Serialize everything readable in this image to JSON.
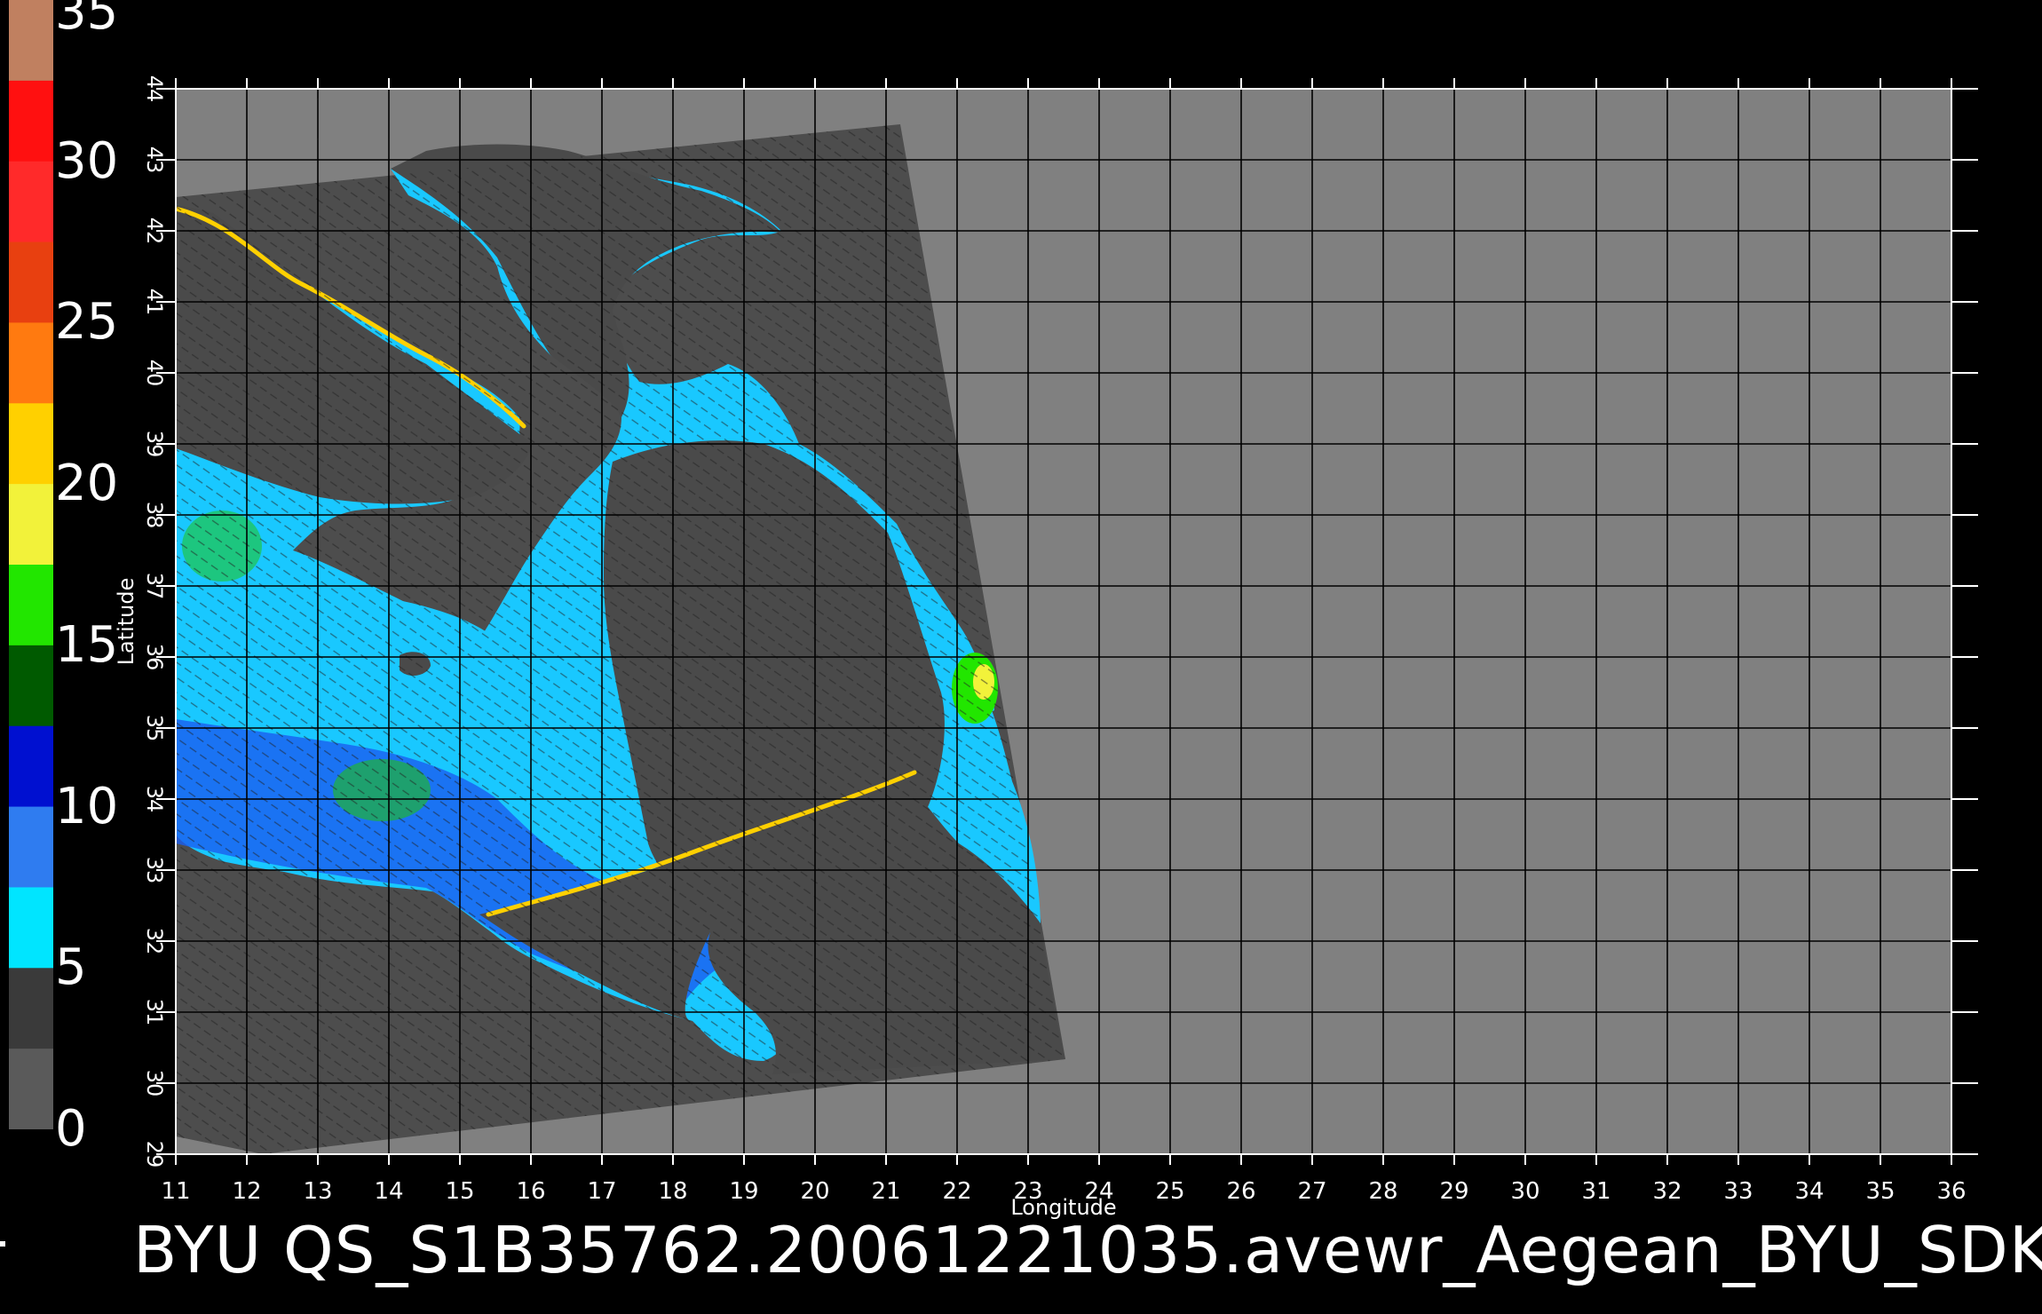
{
  "colorbar": {
    "ticks": [
      "0",
      "5",
      "10",
      "15",
      "20",
      "25",
      "30",
      "35"
    ],
    "stops": [
      {
        "color": "#5a5a5a"
      },
      {
        "color": "#3a3a3a"
      },
      {
        "color": "#00e5ff"
      },
      {
        "color": "#2f7cf0"
      },
      {
        "color": "#0010d0"
      },
      {
        "color": "#005a00"
      },
      {
        "color": "#22e600"
      },
      {
        "color": "#f2f23a"
      },
      {
        "color": "#ffd000"
      },
      {
        "color": "#ff7a10"
      },
      {
        "color": "#e84010"
      },
      {
        "color": "#ff2a2a"
      },
      {
        "color": "#ff1010"
      },
      {
        "color": "#c08060"
      }
    ]
  },
  "axes": {
    "xlabel": "Longitude",
    "ylabel": "Latitude",
    "lon_ticks": [
      "11",
      "12",
      "13",
      "14",
      "15",
      "16",
      "17",
      "18",
      "19",
      "20",
      "21",
      "22",
      "23",
      "24",
      "25",
      "26",
      "27",
      "28",
      "29",
      "30",
      "31",
      "32",
      "33",
      "34",
      "35",
      "36"
    ],
    "lat_ticks": [
      "29",
      "30",
      "31",
      "32",
      "33",
      "34",
      "35",
      "36",
      "37",
      "38",
      "39",
      "40",
      "41",
      "42",
      "43",
      "44"
    ]
  },
  "map": {
    "background_color": "#808080",
    "swath_color": "#4d4d4d",
    "land_color": "#4a4a4a",
    "sea_color": "#19c8ff",
    "deep_color": "#1a5ef0",
    "grid_color": "#000000"
  },
  "caption": "BYU  QS_S1B35762.20061221035.avewr_Aegean_BYU_SDK"
}
